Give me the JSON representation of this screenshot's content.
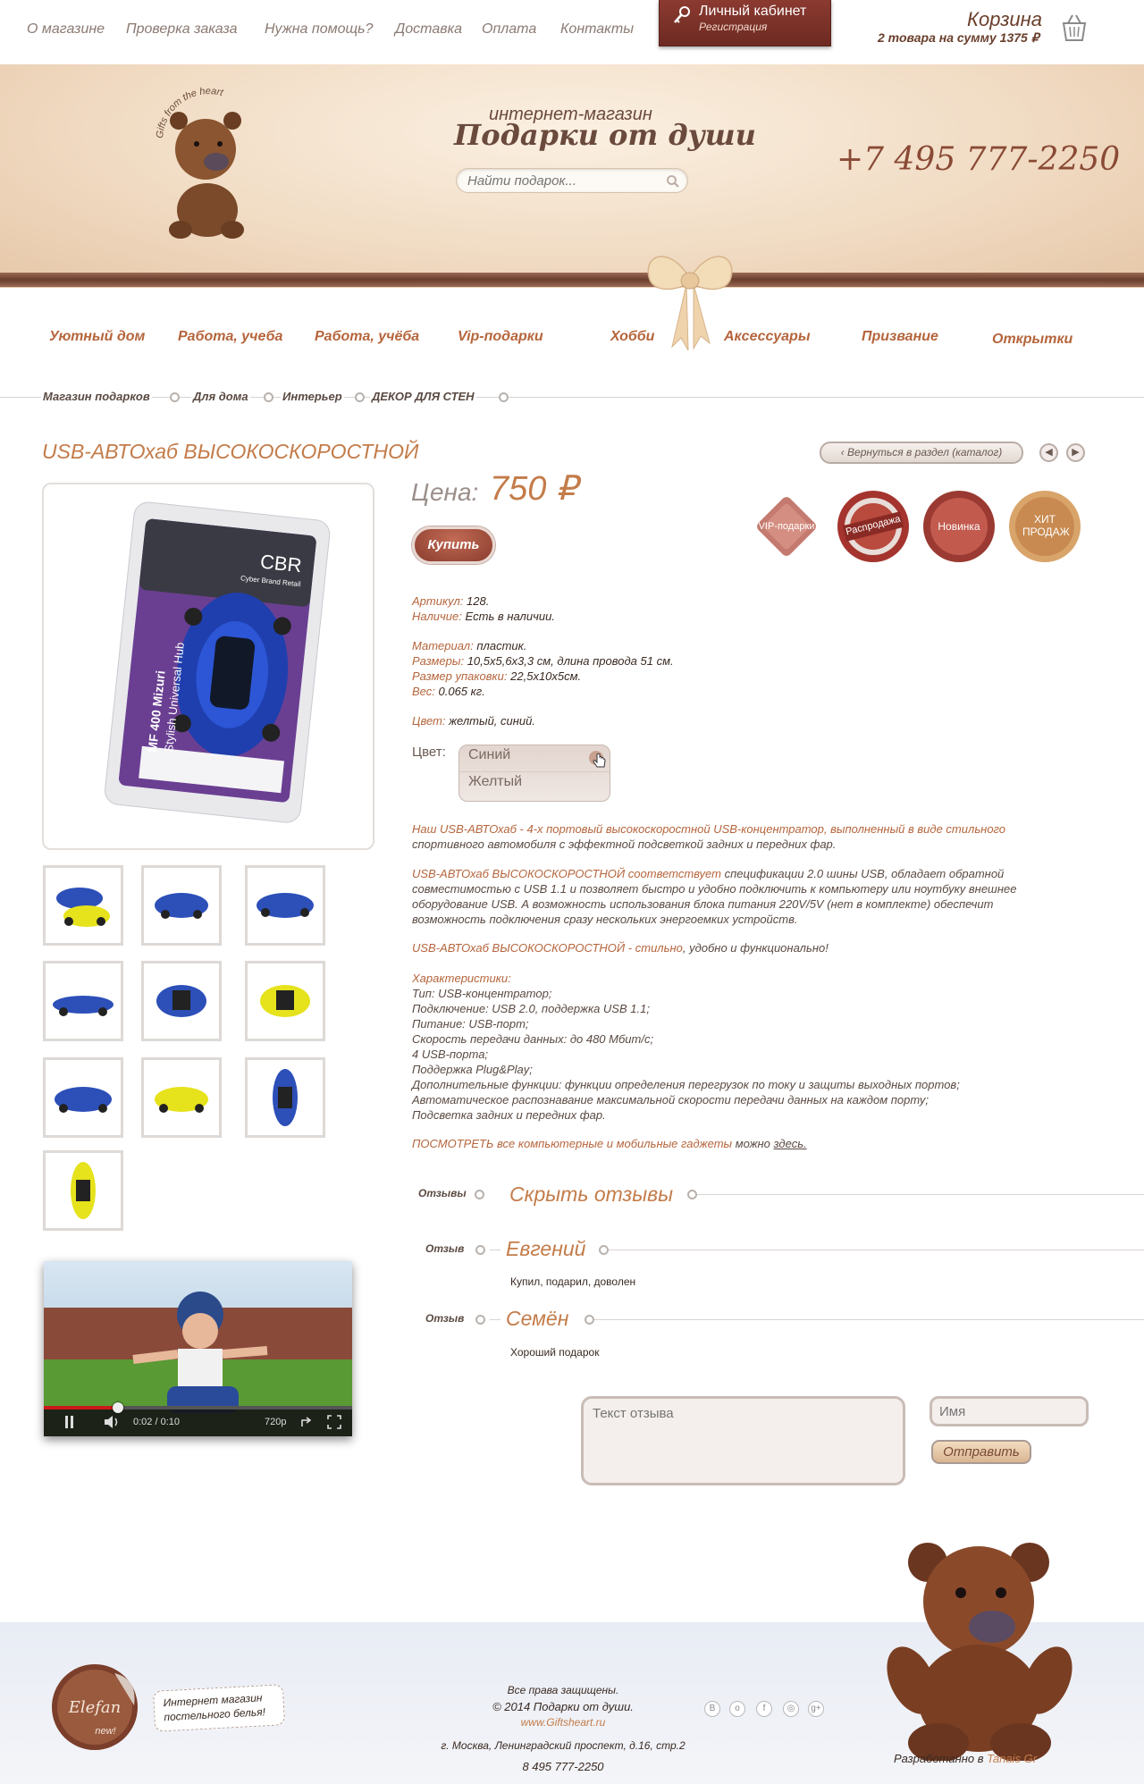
{
  "topnav": [
    "О магазине",
    "Проверка заказа",
    "Нужна помощь?",
    "Доставка",
    "Оплата",
    "Контакты"
  ],
  "cabinet": {
    "title": "Личный кабинет",
    "register": "Регистрация"
  },
  "cart": {
    "title": "Корзина",
    "summary": "2 товара на сумму 1375 ₽"
  },
  "header": {
    "tagline": "интернет-магазин",
    "shop_name": "Подарки от души",
    "logo_ring_text": "Gifts from the heart",
    "search_placeholder": "Найти подарок...",
    "phone": "+7 495 777-2250"
  },
  "nav": [
    "Уютный дом",
    "Работа, учеба",
    "Работа, учёба",
    "Vip-подарки",
    "Хобби",
    "Аксессуары",
    "Призвание",
    "Открытки"
  ],
  "breadcrumb": [
    "Магазин подарков",
    "Для дома",
    "Интерьер",
    "ДЕКОР ДЛЯ СТЕН"
  ],
  "product": {
    "title": "USB-АВТОхаб ВЫСОКОСКОРОСТНОЙ",
    "back_label": "Вернуться в раздел (каталог)",
    "price_label": "Цена:",
    "price_value": "750 ₽",
    "buy_label": "Купить",
    "badges": [
      "VIP-подарки",
      "Распродажа",
      "Новинка",
      "ХИТ ПРОДАЖ"
    ],
    "package_brand": "CBR",
    "package_sub": "Cyber Brand Retail",
    "package_model": "MF 400 Mizuri",
    "package_desc": "Stylish Universal Hub",
    "props": {
      "article_k": "Артикул:",
      "article_v": "128.",
      "stock_k": "Наличие:",
      "stock_v": "Есть в наличии.",
      "material_k": "Материал:",
      "material_v": "пластик.",
      "size_k": "Размеры:",
      "size_v": "10,5x5,6x3,3 см, длина провода 51 см.",
      "pack_k": "Размер упаковки:",
      "pack_v": "22,5x10x5см.",
      "weight_k": "Вес:",
      "weight_v": "0.065 кг.",
      "color_k": "Цвет:",
      "color_v": "желтый, синий."
    },
    "color_label": "Цвет:",
    "color_options": [
      "Синий",
      "Желтый"
    ],
    "desc1_a": "Наш USB-АВТОхаб - 4-х портовый высокоскоростной USB-концентратор, выполненный в виде стильного",
    "desc1_b": "спортивного автомобиля с эффектной подсветкой задних и передних фар.",
    "desc2_acc": "USB-АВТОхаб ВЫСОКОСКОРОСТНОЙ соответствует",
    "desc2_a": " спецификации 2.0 шины USB, обладает обратной",
    "desc2_b": "совместимостью с USB 1.1 и позволяет быстро и удобно подключить к компьютеру или ноутбуку внешнее",
    "desc2_c": "оборудование USB. А возможность использования блока питания 220V/5V (нет в комплекте) обеспечит",
    "desc2_d": "возможность подключения сразу нескольких энергоемких устройств.",
    "desc3_acc": "USB-АВТОхаб ВЫСОКОСКОРОСТНОЙ - стильно",
    "desc3_a": ", удобно и функционально!",
    "spec_title": "Характеристики:",
    "specs": [
      "Тип: USB-концентратор;",
      "Подключение: USB 2.0, поддержка USB 1.1;",
      "Питание: USB-порт;",
      "Скорость передачи данных: до 480 Мбит/с;",
      "4 USB-порта;",
      "Поддержка Plug&Play;",
      "Дополнительные функции: функции определения перегрузок по току и защиты выходных портов;",
      "Автоматическое распознавание максимальной скорости передачи данных на каждом порту;",
      "Подсветка задних и передних фар."
    ],
    "more_acc": "ПОСМОТРЕТЬ все компьютерные и мобильные гаджеты",
    "more_mid": " можно ",
    "more_link": "здесь."
  },
  "thumb_colors": [
    "#2c4fb8",
    "#2c4fb8",
    "#2c4fb8",
    "#2c4fb8",
    "#2c4fb8",
    "#e6e21c",
    "#2c4fb8",
    "#e6e21c",
    "#2c4fb8",
    "#e6e21c"
  ],
  "reviews": {
    "section_label": "Отзывы",
    "toggle_label": "Скрыть отзывы",
    "item_label": "Отзыв",
    "items": [
      {
        "name": "Евгений",
        "text": "Купил, подарил, доволен"
      },
      {
        "name": "Семён",
        "text": "Хороший подарок"
      }
    ],
    "text_placeholder": "Текст отзыва",
    "name_placeholder": "Имя",
    "send_label": "Отправить"
  },
  "video": {
    "time": "0:02 / 0:10",
    "quality": "720p",
    "progress": 0.24
  },
  "footer": {
    "partner_logo": "Elefan",
    "partner_badge": "new!",
    "partner_text_1": "Интернет магазин",
    "partner_text_2": "постельного белья!",
    "rights": "Все права защищены.",
    "copy": "© 2014 Подарки от души.",
    "site": "www.Giftsheart.ru",
    "address": "г. Москва, Ленинградский проспект, д.16, стр.2",
    "phone": "8 495 777-2250",
    "dev_prefix": "Разработанно в",
    "dev_name": "Tanais Gr",
    "social": [
      "В",
      "о",
      "f",
      "◎",
      "g+"
    ]
  },
  "colors": {
    "accent": "#c37c4a",
    "brand_dark": "#6d2a22",
    "ribbon": "#6a3e2d"
  }
}
